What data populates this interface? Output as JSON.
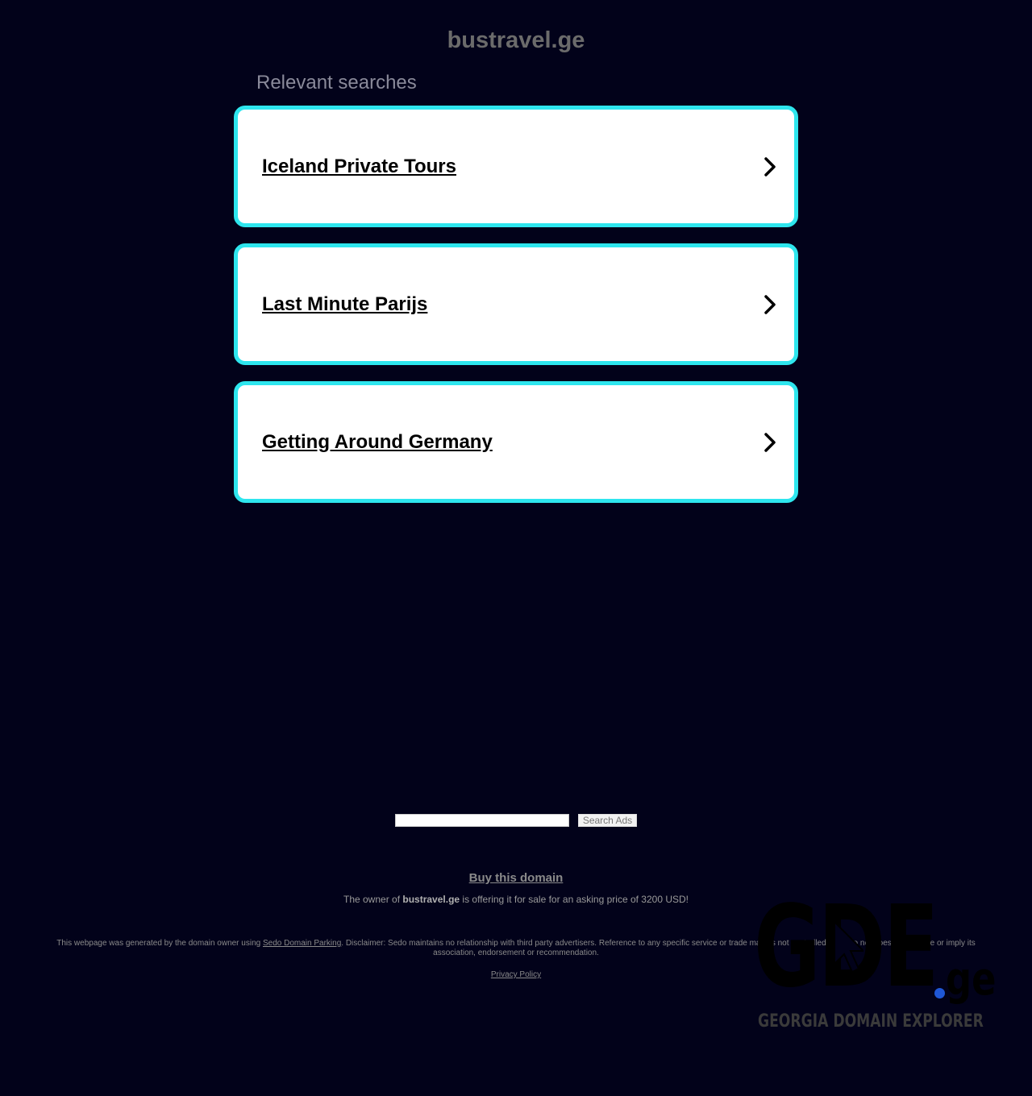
{
  "header": {
    "domain": "bustravel.ge",
    "section_title": "Relevant searches"
  },
  "searches": [
    {
      "label": "Iceland Private Tours",
      "icon": "chevron-right-icon"
    },
    {
      "label": "Last Minute Parijs",
      "icon": "chevron-right-icon"
    },
    {
      "label": "Getting Around Germany",
      "icon": "chevron-right-icon"
    }
  ],
  "search_bar": {
    "value": "",
    "button_label": "Search Ads"
  },
  "sale": {
    "buy_label": "Buy this domain",
    "owner_prefix": "The owner of ",
    "domain": "bustravel.ge",
    "owner_suffix": " is offering it for sale for an asking price of 3200 USD!"
  },
  "footer": {
    "generated_prefix": "This webpage was generated by the domain owner using ",
    "sedo_link": "Sedo Domain Parking",
    "disclaimer": ". Disclaimer: Sedo maintains no relationship with third party advertisers. Reference to any specific service or trade mark is not controlled by Sedo nor does it constitute or imply its association, endorsement or recommendation.",
    "privacy_link": "Privacy Policy"
  },
  "watermark": {
    "main": "GDE",
    "tld": "ge",
    "tagline": "GEORGIA DOMAIN EXPLORER",
    "dot_color": "#1f57d6"
  },
  "colors": {
    "background": "#02021a",
    "card_border": "#2ee6ee",
    "card_background": "#ffffff"
  }
}
